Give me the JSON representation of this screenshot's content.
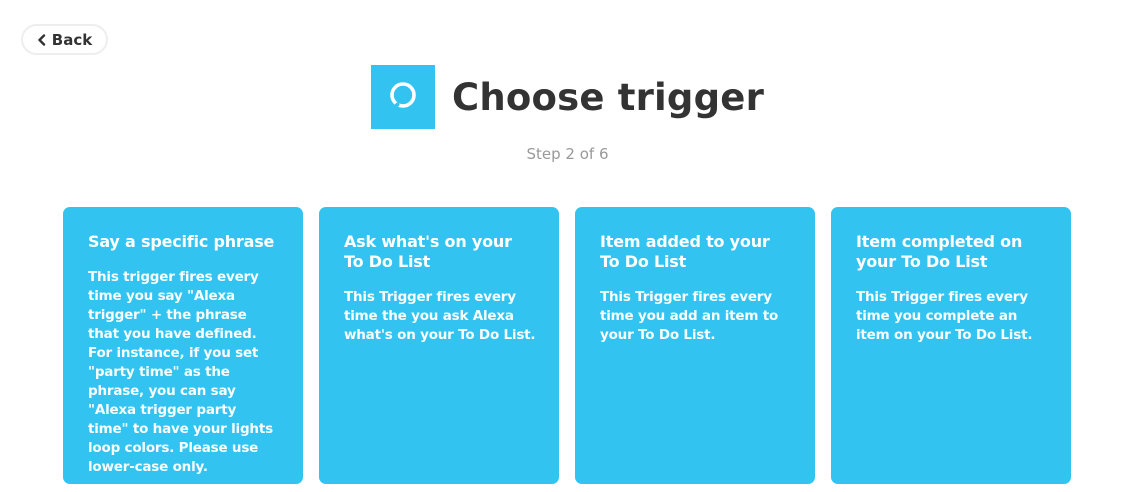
{
  "back": {
    "label": "Back",
    "icon": "chevron-left-icon"
  },
  "header": {
    "logo_icon": "alexa-ring-icon",
    "logo_color": "#33c3f0",
    "title": "Choose trigger",
    "step": "Step 2 of 6"
  },
  "triggers": [
    {
      "title": "Say a specific phrase",
      "description": "This trigger fires every time you say \"Alexa trigger\" + the phrase that you have defined. For instance, if you set \"party time\" as the phrase, you can say \"Alexa trigger party time\" to have your lights loop colors. Please use lower-case only."
    },
    {
      "title": "Ask what's on your To Do List",
      "description": "This Trigger fires every time the you ask Alexa what's on your To Do List."
    },
    {
      "title": "Item added to your To Do List",
      "description": "This Trigger fires every time you add an item to your To Do List."
    },
    {
      "title": "Item completed on your To Do List",
      "description": "This Trigger fires every time you complete an item on your To Do List."
    }
  ],
  "colors": {
    "card_background": "#33c3f0",
    "title_text": "#333333",
    "muted_text": "#999999"
  }
}
